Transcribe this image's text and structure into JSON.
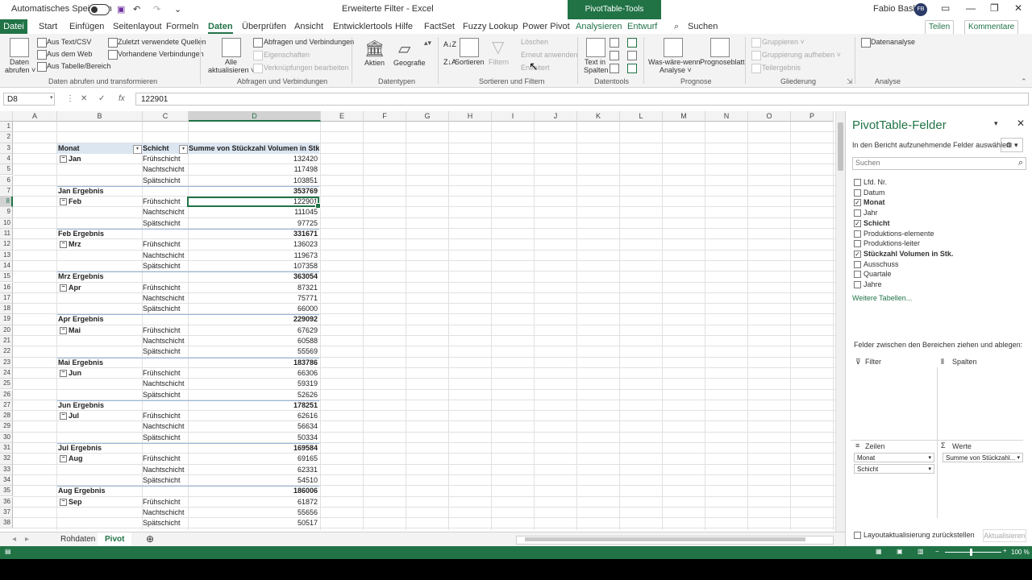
{
  "titlebar": {
    "autosave": "Automatisches Speichern",
    "doc": "Erweiterte Filter - Excel",
    "pivot_tools": "PivotTable-Tools",
    "search": "Suchen",
    "user": "Fabio Basler",
    "initials": "FB"
  },
  "menu": [
    "Datei",
    "Start",
    "Einfügen",
    "Seitenlayout",
    "Formeln",
    "Daten",
    "Überprüfen",
    "Ansicht",
    "Entwicklertools",
    "Hilfe",
    "FactSet",
    "Fuzzy Lookup",
    "Power Pivot",
    "Analysieren",
    "Entwurf"
  ],
  "share": {
    "tellen": "Teilen",
    "kommentare": "Kommentare"
  },
  "ribbon": {
    "g1": {
      "big": "Daten",
      "big2": "abrufen ˅",
      "a": "Aus Text/CSV",
      "b": "Aus dem Web",
      "c": "Aus Tabelle/Bereich",
      "d": "Zuletzt verwendete Quellen",
      "e": "Vorhandene Verbindungen",
      "label": "Daten abrufen und transformieren"
    },
    "g2": {
      "big": "Alle",
      "big2": "aktualisieren ˅",
      "a": "Abfragen und Verbindungen",
      "b": "Eigenschaften",
      "c": "Verknüpfungen bearbeiten",
      "label": "Abfragen und Verbindungen"
    },
    "g3": {
      "a": "Aktien",
      "b": "Geografie",
      "label": "Datentypen"
    },
    "g4": {
      "sort": "Sortieren",
      "filter": "Filtern",
      "a": "Löschen",
      "b": "Erneut anwenden",
      "c": "Erweitert",
      "label": "Sortieren und Filtern"
    },
    "g5": {
      "a": "Text in",
      "b": "Spalten",
      "label": "Datentools"
    },
    "g6": {
      "a": "Was-wäre-wenn-",
      "b": "Analyse ˅",
      "c": "Prognoseblatt",
      "label": "Prognose"
    },
    "g7": {
      "a": "Gruppieren ˅",
      "b": "Gruppierung aufheben ˅",
      "c": "Teilergebnis",
      "label": "Gliederung"
    },
    "g8": {
      "a": "Datenanalyse",
      "label": "Analyse"
    }
  },
  "formula": {
    "cell": "D8",
    "value": "122901"
  },
  "columns": [
    "A",
    "B",
    "C",
    "D",
    "E",
    "F",
    "G",
    "H",
    "I",
    "J",
    "K",
    "L",
    "M",
    "N",
    "O",
    "P"
  ],
  "table": {
    "h_monat": "Monat",
    "h_schicht": "Schicht",
    "h_sum": "Summe von Stückzahl Volumen in Stk.",
    "rows": [
      {
        "r": "1",
        "b": "",
        "c": "",
        "d": "",
        "t": "blank"
      },
      {
        "r": "2",
        "b": "",
        "c": "",
        "d": "",
        "t": "blank"
      },
      {
        "r": "3",
        "b": "",
        "c": "",
        "d": "",
        "t": "header"
      },
      {
        "r": "4",
        "b": "Jan",
        "c": "Frühschicht",
        "d": "132420",
        "t": "first"
      },
      {
        "r": "5",
        "b": "",
        "c": "Nachtschicht",
        "d": "117498",
        "t": "item"
      },
      {
        "r": "6",
        "b": "",
        "c": "Spätschicht",
        "d": "103851",
        "t": "item"
      },
      {
        "r": "7",
        "b": "Jan Ergebnis",
        "c": "",
        "d": "353769",
        "t": "sub"
      },
      {
        "r": "8",
        "b": "Feb",
        "c": "Frühschicht",
        "d": "122901",
        "t": "first"
      },
      {
        "r": "9",
        "b": "",
        "c": "Nachtschicht",
        "d": "111045",
        "t": "item"
      },
      {
        "r": "10",
        "b": "",
        "c": "Spätschicht",
        "d": "97725",
        "t": "item"
      },
      {
        "r": "11",
        "b": "Feb Ergebnis",
        "c": "",
        "d": "331671",
        "t": "sub"
      },
      {
        "r": "12",
        "b": "Mrz",
        "c": "Frühschicht",
        "d": "136023",
        "t": "first"
      },
      {
        "r": "13",
        "b": "",
        "c": "Nachtschicht",
        "d": "119673",
        "t": "item"
      },
      {
        "r": "14",
        "b": "",
        "c": "Spätschicht",
        "d": "107358",
        "t": "item"
      },
      {
        "r": "15",
        "b": "Mrz Ergebnis",
        "c": "",
        "d": "363054",
        "t": "sub"
      },
      {
        "r": "16",
        "b": "Apr",
        "c": "Frühschicht",
        "d": "87321",
        "t": "first"
      },
      {
        "r": "17",
        "b": "",
        "c": "Nachtschicht",
        "d": "75771",
        "t": "item"
      },
      {
        "r": "18",
        "b": "",
        "c": "Spätschicht",
        "d": "66000",
        "t": "item"
      },
      {
        "r": "19",
        "b": "Apr Ergebnis",
        "c": "",
        "d": "229092",
        "t": "sub"
      },
      {
        "r": "20",
        "b": "Mai",
        "c": "Frühschicht",
        "d": "67629",
        "t": "first"
      },
      {
        "r": "21",
        "b": "",
        "c": "Nachtschicht",
        "d": "60588",
        "t": "item"
      },
      {
        "r": "22",
        "b": "",
        "c": "Spätschicht",
        "d": "55569",
        "t": "item"
      },
      {
        "r": "23",
        "b": "Mai Ergebnis",
        "c": "",
        "d": "183786",
        "t": "sub"
      },
      {
        "r": "24",
        "b": "Jun",
        "c": "Frühschicht",
        "d": "66306",
        "t": "first"
      },
      {
        "r": "25",
        "b": "",
        "c": "Nachtschicht",
        "d": "59319",
        "t": "item"
      },
      {
        "r": "26",
        "b": "",
        "c": "Spätschicht",
        "d": "52626",
        "t": "item"
      },
      {
        "r": "27",
        "b": "Jun Ergebnis",
        "c": "",
        "d": "178251",
        "t": "sub"
      },
      {
        "r": "28",
        "b": "Jul",
        "c": "Frühschicht",
        "d": "62616",
        "t": "first"
      },
      {
        "r": "29",
        "b": "",
        "c": "Nachtschicht",
        "d": "56634",
        "t": "item"
      },
      {
        "r": "30",
        "b": "",
        "c": "Spätschicht",
        "d": "50334",
        "t": "item"
      },
      {
        "r": "31",
        "b": "Jul Ergebnis",
        "c": "",
        "d": "169584",
        "t": "sub"
      },
      {
        "r": "32",
        "b": "Aug",
        "c": "Frühschicht",
        "d": "69165",
        "t": "first"
      },
      {
        "r": "33",
        "b": "",
        "c": "Nachtschicht",
        "d": "62331",
        "t": "item"
      },
      {
        "r": "34",
        "b": "",
        "c": "Spätschicht",
        "d": "54510",
        "t": "item"
      },
      {
        "r": "35",
        "b": "Aug Ergebnis",
        "c": "",
        "d": "186006",
        "t": "sub"
      },
      {
        "r": "36",
        "b": "Sep",
        "c": "Frühschicht",
        "d": "61872",
        "t": "first"
      },
      {
        "r": "37",
        "b": "",
        "c": "Nachtschicht",
        "d": "55656",
        "t": "item"
      },
      {
        "r": "38",
        "b": "",
        "c": "Spätschicht",
        "d": "50517",
        "t": "item"
      }
    ]
  },
  "sheets": [
    "Rohdaten",
    "Pivot"
  ],
  "pane": {
    "title": "PivotTable-Felder",
    "subtitle": "In den Bericht aufzunehmende Felder auswählen:",
    "search": "Suchen",
    "fields": [
      {
        "name": "Lfd. Nr.",
        "checked": false
      },
      {
        "name": "Datum",
        "checked": false
      },
      {
        "name": "Monat",
        "checked": true
      },
      {
        "name": "Jahr",
        "checked": false
      },
      {
        "name": "Schicht",
        "checked": true
      },
      {
        "name": "Produktions-elemente",
        "checked": false
      },
      {
        "name": "Produktions-leiter",
        "checked": false
      },
      {
        "name": "Stückzahl Volumen in Stk.",
        "checked": true
      },
      {
        "name": "Ausschuss",
        "checked": false
      },
      {
        "name": "Quartale",
        "checked": false
      },
      {
        "name": "Jahre",
        "checked": false
      }
    ],
    "more": "Weitere Tabellen...",
    "drag": "Felder zwischen den Bereichen ziehen und ablegen:",
    "filter": "Filter",
    "spalten": "Spalten",
    "zeilen": "Zeilen",
    "werte": "Werte",
    "zeilen_items": [
      "Monat",
      "Schicht"
    ],
    "werte_items": [
      "Summe von Stückzahl..."
    ],
    "defer": "Layoutaktualisierung zurückstellen",
    "update": "Aktualisieren"
  },
  "status": {
    "zoom": "100 %"
  },
  "colors": {
    "accent": "#217346",
    "pivot_header": "#dce6f1"
  }
}
